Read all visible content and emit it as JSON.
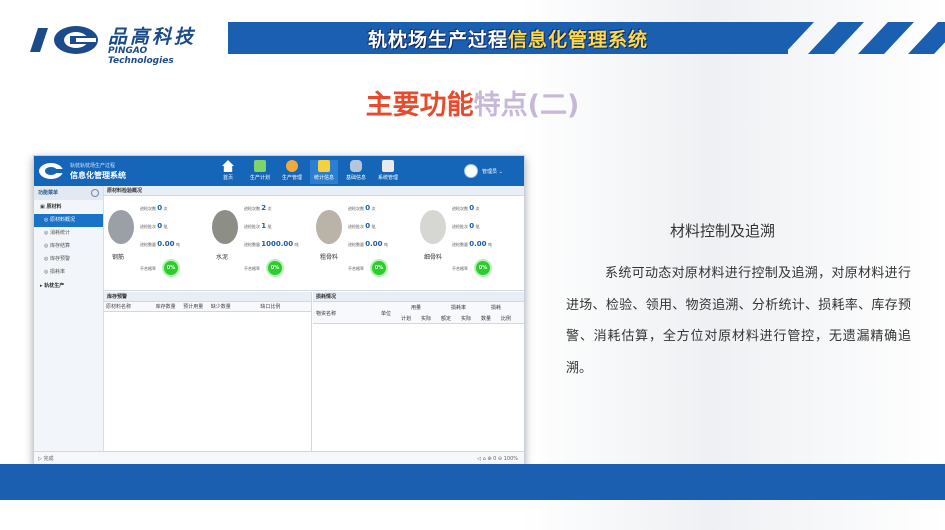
{
  "header": {
    "logo_cn": "品高科技",
    "logo_en": "PINGAO Technologies",
    "banner_title_part1": "轨枕场生产过程",
    "banner_title_part2": "信息化管理系统",
    "subtitle_part1": "主要功能",
    "subtitle_part2": "特点(二)"
  },
  "app": {
    "name_line1": "轨枕轨枕场生产过程",
    "name_line2": "信息化管理系统",
    "nav": [
      {
        "label": "首页",
        "icon": "home-icon",
        "color": "#ffffff"
      },
      {
        "label": "生产计划",
        "icon": "plan-icon",
        "color": "#7fd36b"
      },
      {
        "label": "生产管理",
        "icon": "production-icon",
        "color": "#f0a93a"
      },
      {
        "label": "统计信息",
        "icon": "statistics-icon",
        "color": "#f3d23e"
      },
      {
        "label": "基础信息",
        "icon": "database-icon",
        "color": "#b5c6da"
      },
      {
        "label": "系统管理",
        "icon": "tools-icon",
        "color": "#e9e9e9"
      }
    ],
    "user_name": "管理员",
    "sidebar": {
      "header": "功能菜单",
      "group1": "原材料",
      "items": [
        "原材料概况",
        "消耗统计",
        "库存结算",
        "库存预警",
        "损耗率"
      ],
      "group2": "轨枕生产"
    },
    "overview": {
      "title": "原材料检验概况",
      "materials": [
        {
          "name": "钢筋",
          "line1_label": "进检次数",
          "line1_value": "0",
          "line1_unit": "次",
          "line2_label": "进检批次",
          "line2_value": "0",
          "line2_unit": "批",
          "line3_label": "进检数量",
          "line3_value": "0.00",
          "line3_unit": "吨",
          "pass_label": "不合格率",
          "pass_value": "0%",
          "color": "#9aa0a6"
        },
        {
          "name": "水泥",
          "line1_label": "进检次数",
          "line1_value": "2",
          "line1_unit": "次",
          "line2_label": "进检批次",
          "line2_value": "1",
          "line2_unit": "批",
          "line3_label": "进检数量",
          "line3_value": "1000.00",
          "line3_unit": "吨",
          "pass_label": "不合格率",
          "pass_value": "0%",
          "color": "#8d8f87"
        },
        {
          "name": "粗骨料",
          "line1_label": "进检次数",
          "line1_value": "0",
          "line1_unit": "次",
          "line2_label": "进检批次",
          "line2_value": "0",
          "line2_unit": "批",
          "line3_label": "进检数量",
          "line3_value": "0.00",
          "line3_unit": "吨",
          "pass_label": "不合格率",
          "pass_value": "0%",
          "color": "#b9b3a8"
        },
        {
          "name": "细骨料",
          "line1_label": "进检次数",
          "line1_value": "0",
          "line1_unit": "次",
          "line2_label": "进检批次",
          "line2_value": "0",
          "line2_unit": "批",
          "line3_label": "进检数量",
          "line3_value": "0.00",
          "line3_unit": "吨",
          "pass_label": "不合格率",
          "pass_value": "0%",
          "color": "#d6d6d2"
        }
      ]
    },
    "stock_panel": {
      "title": "库存预警",
      "columns": [
        "原材料名称",
        "库存数量",
        "预计用量",
        "缺少数量",
        "缺口比例"
      ]
    },
    "loss_panel": {
      "title": "损耗情况",
      "col_name": "物资名称",
      "col_unit": "单位",
      "col_usage": "用量",
      "col_loss": "损耗率",
      "col_loss_amount": "损耗",
      "sub": [
        "计划",
        "实际",
        "额定",
        "实际",
        "数量",
        "比例"
      ]
    },
    "statusbar_left": "完成",
    "statusbar_zoom": "100%"
  },
  "description": {
    "title": "材料控制及追溯",
    "body": "系统可动态对原材料进行控制及追溯，对原材料进行进场、检验、领用、物资追溯、分析统计、损耗率、库存预警、消耗估算，全方位对原材料进行管控，无遗漏精确追溯。"
  },
  "colors": {
    "brand_blue": "#1b5fb0",
    "subtitle_red": "#e84a2c",
    "subtitle_purple": "#c7b7d8",
    "pass_green": "#2ecc2e"
  }
}
